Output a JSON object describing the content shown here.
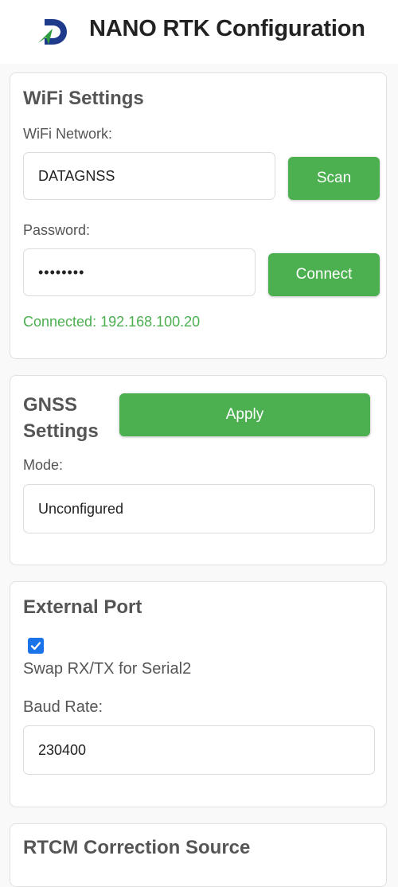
{
  "header": {
    "title": "NANO RTK Configuration",
    "logo_icon": "datagnss-logo-icon"
  },
  "wifi": {
    "title": "WiFi Settings",
    "network_label": "WiFi Network:",
    "network_value": "DATAGNSS",
    "scan_label": "Scan",
    "password_label": "Password:",
    "password_value": "••••••••",
    "connect_label": "Connect",
    "status": "Connected: 192.168.100.20"
  },
  "gnss": {
    "title_line1": "GNSS",
    "title_line2": "Settings",
    "apply_label": "Apply",
    "mode_label": "Mode:",
    "mode_value": "Unconfigured"
  },
  "external_port": {
    "title": "External Port",
    "swap_checked": true,
    "swap_label": "Swap RX/TX for Serial2",
    "baud_label": "Baud Rate:",
    "baud_value": "230400"
  },
  "rtcm": {
    "title": "RTCM Correction Source"
  },
  "colors": {
    "accent": "#4caf50",
    "checkbox": "#1a73e8",
    "logo_blue": "#1e3a8a",
    "logo_green": "#2e9c3e"
  }
}
